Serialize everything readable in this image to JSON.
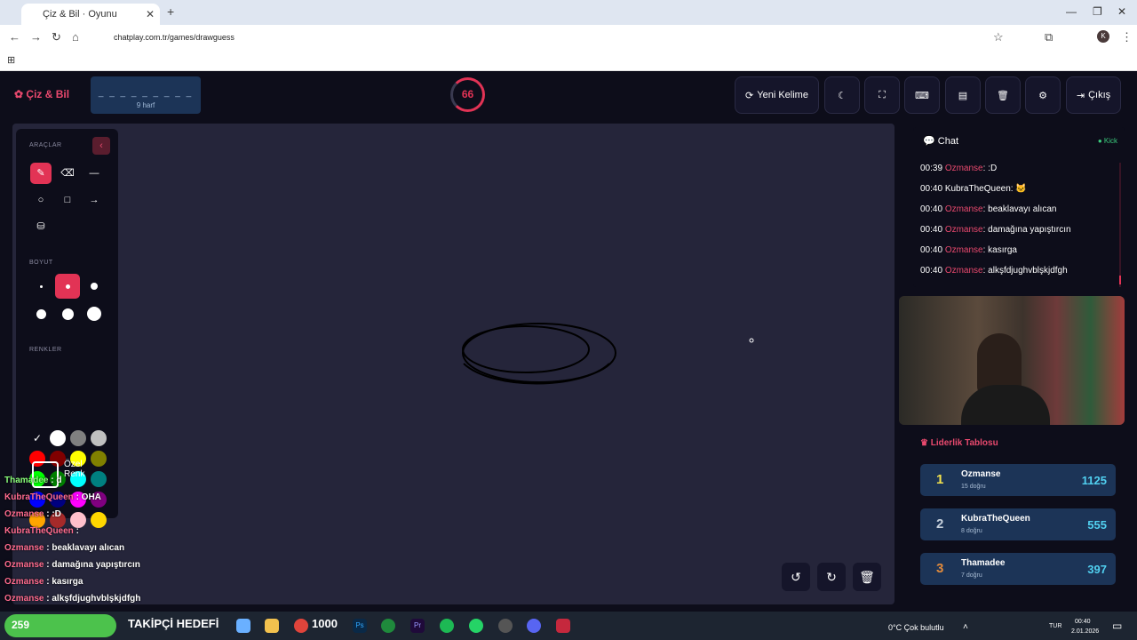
{
  "browser": {
    "tab_title": "Çiz & Bil · Oyunu",
    "url": "chatplay.com.tr/games/drawguess",
    "profile_initial": "K"
  },
  "header": {
    "logo": "Çiz & Bil",
    "word_mask": "_ _ _ _ _ _ _ _ _",
    "word_hint": "9 harf",
    "timer": "66",
    "new_word_label": "Yeni Kelime",
    "exit_label": "Çıkış"
  },
  "tools": {
    "title": "ARAÇLAR",
    "size_title": "BOYUT",
    "colors_title": "RENKLER",
    "custom_color_label": "Özel Renk",
    "colors": [
      "#ffffff",
      "#ffffff",
      "#808080",
      "#c0c0c0",
      "#ff0000",
      "#800000",
      "#ffff00",
      "#808000",
      "#00ff00",
      "#008000",
      "#00ffff",
      "#008080",
      "#0000ff",
      "#000080",
      "#ff00ff",
      "#800080",
      "#ffa500",
      "#a52a2a",
      "#ffc0cb",
      "#ffd700"
    ]
  },
  "chat": {
    "title": "Chat",
    "kick_label": "Kick",
    "messages": [
      {
        "time": "00:39",
        "user": "Ozmanse",
        "text": ":D",
        "user_color": "#e9496e"
      },
      {
        "time": "00:40",
        "user": "KubraTheQueen",
        "text": "",
        "user_color": "#ffffff"
      },
      {
        "time": "00:40",
        "user": "Ozmanse",
        "text": "beaklavayı alıcan",
        "user_color": "#e9496e"
      },
      {
        "time": "00:40",
        "user": "Ozmanse",
        "text": "damağına yapıştırcın",
        "user_color": "#e9496e"
      },
      {
        "time": "00:40",
        "user": "Ozmanse",
        "text": "kasırga",
        "user_color": "#e9496e"
      },
      {
        "time": "00:40",
        "user": "Ozmanse",
        "text": "alkşfdjughvblşkjdfgh",
        "user_color": "#e9496e"
      }
    ]
  },
  "leaderboard": {
    "title": "Liderlik Tablosu",
    "entries": [
      {
        "rank": "1",
        "name": "Ozmanse",
        "sub": "15 doğru",
        "score": "1125",
        "rank_color": "#f4e24d"
      },
      {
        "rank": "2",
        "name": "KubraTheQueen",
        "sub": "8 doğru",
        "score": "555",
        "rank_color": "#c6d0dc"
      },
      {
        "rank": "3",
        "name": "Thamadee",
        "sub": "7 doğru",
        "score": "397",
        "rank_color": "#e08a3c"
      }
    ]
  },
  "overlay_chat": [
    {
      "user": "Thamadee",
      "text": " : d"
    },
    {
      "user": "KubraTheQueen",
      "text": " : OHA"
    },
    {
      "user": "Ozmanse",
      "text": " : :D"
    },
    {
      "user": "KubraTheQueen",
      "text": " :"
    },
    {
      "user": "Ozmanse",
      "text": " : beaklavayı alıcan"
    },
    {
      "user": "Ozmanse",
      "text": " : damağına yapıştırcın"
    },
    {
      "user": "Ozmanse",
      "text": " : kasırga"
    },
    {
      "user": "Ozmanse",
      "text": " : alkşfdjughvblşkjdfgh"
    }
  ],
  "stream_overlay": {
    "counter": "259",
    "goal_label": "TAKİPÇİ HEDEFİ",
    "goal_value": "1000"
  },
  "taskbar": {
    "weather": "0°C  Çok bulutlu",
    "lang": "TUR",
    "time": "00:40",
    "date": "2.01.2026"
  }
}
